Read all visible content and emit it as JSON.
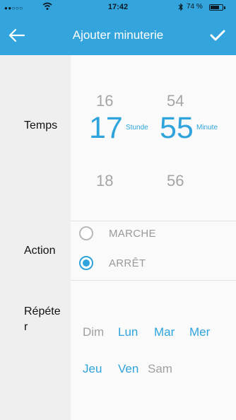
{
  "status_bar": {
    "signal": "●●○○○",
    "time": "17:42",
    "battery_percent": "74 %",
    "battery_level": 0.74
  },
  "nav": {
    "title": "Ajouter minuterie"
  },
  "time_section": {
    "label": "Temps",
    "hour_prev": "16",
    "hour_selected": "17",
    "hour_next": "18",
    "hour_unit": "Stunde",
    "minute_prev": "54",
    "minute_selected": "55",
    "minute_next": "56",
    "minute_unit": "Minute"
  },
  "action_section": {
    "label": "Action",
    "options": [
      {
        "label": "MARCHE",
        "selected": false
      },
      {
        "label": "ARRÊT",
        "selected": true
      }
    ]
  },
  "repeat_section": {
    "label_line1": "Répéte",
    "label_line2": "r",
    "days": [
      {
        "label": "Dim",
        "active": false
      },
      {
        "label": "Lun",
        "active": true
      },
      {
        "label": "Mar",
        "active": true
      },
      {
        "label": "Mer",
        "active": true
      },
      {
        "label": "Jeu",
        "active": true
      },
      {
        "label": "Ven",
        "active": true
      },
      {
        "label": "Sam",
        "active": false
      }
    ]
  },
  "colors": {
    "accent": "#2fa3db",
    "header": "#34a4dc",
    "inactive": "#a0a0a0"
  }
}
